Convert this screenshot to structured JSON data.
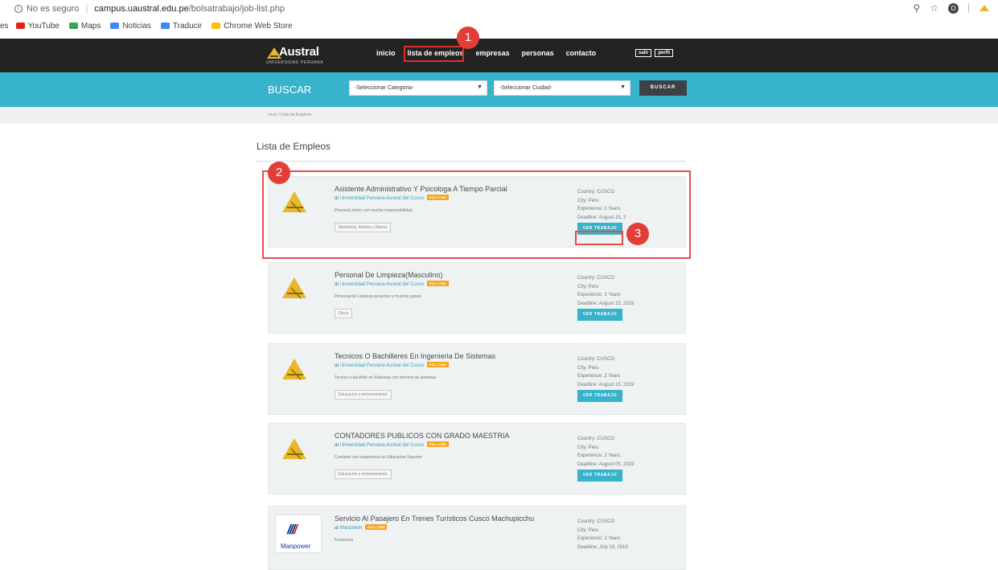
{
  "browser": {
    "insecure_label": "No es seguro",
    "url_host": "campus.uaustral.edu.pe",
    "url_path": "/bolsatrabajo/job-list.php",
    "bookmarks": [
      {
        "label": "es"
      },
      {
        "label": "YouTube",
        "color": "#e62117"
      },
      {
        "label": "Maps",
        "color": "#34a853"
      },
      {
        "label": "Noticias",
        "color": "#4285f4"
      },
      {
        "label": "Traducir",
        "color": "#4285f4"
      },
      {
        "label": "Chrome Web Store",
        "color": "#fbbc05"
      }
    ]
  },
  "site": {
    "logo_name": "Austral",
    "logo_sub": "UNIVERSIDAD PERUANA",
    "menu": [
      "inicio",
      "lista de empleos",
      "empresas",
      "personas",
      "contacto"
    ],
    "mini_buttons": [
      "salir",
      "perfil"
    ],
    "search": {
      "label": "BUSCAR",
      "category_placeholder": "-Seleccionar Categoria-",
      "city_placeholder": "-Seleccionar Ciudad-",
      "button": "BUSCAR"
    },
    "breadcrumb": {
      "home": "Inicio",
      "sep": "/",
      "current": "Lista de Empleos"
    },
    "page_title": "Lista de Empleos"
  },
  "jobs": [
    {
      "title": "Asistente Administrativo Y Psicologa A Tiempo Parcial",
      "at": "at",
      "company": "Universidad Peruana Austral del Cusco",
      "badge": "FULL-TIME",
      "desc": "Personal activo con mucha responsabilidad",
      "tag": "Marketing, Medios y Marca",
      "country": "Country: CUSCO",
      "city": "City: Peru",
      "experience": "Experience: 2 Years",
      "deadline": "Deadline: August 15, 2",
      "button": "VER TRABAJO"
    },
    {
      "title": "Personal De Limpieza(Masculino)",
      "at": "at",
      "company": "Universidad Peruana Austral del Cusco",
      "badge": "FULL-TIME",
      "desc": "Personal de Limpieza proactivo y muchas ganas",
      "tag": "Otros",
      "country": "Country: CUSCO",
      "city": "City: Peru",
      "experience": "Experience: 2 Years",
      "deadline": "Deadline: August 15, 2019",
      "button": "VER TRABAJO"
    },
    {
      "title": "Tecnicos O Bachilleres En Ingenieria De Sistemas",
      "at": "at",
      "company": "Universidad Peruana Austral del Cusco",
      "badge": "FULL-TIME",
      "desc": "Tecnico o bachiller en Sistemas con dominio de sistemas",
      "tag": "Educacion y entrenamiento",
      "country": "Country: CUSCO",
      "city": "City: Peru",
      "experience": "Experience: 2 Years",
      "deadline": "Deadline: August 15, 2019",
      "button": "VER TRABAJO"
    },
    {
      "title": "CONTADORES PUBLICOS CON GRADO MAESTRIA",
      "at": "at",
      "company": "Universidad Peruana Austral del Cusco",
      "badge": "FULL-TIME",
      "desc": "Contador con experiencia en Educacion Superior",
      "tag": "Educacion y entrenamiento",
      "country": "Country: CUSCO",
      "city": "City: Peru",
      "experience": "Experience: 2 Years",
      "deadline": "Deadline: August 05, 2019",
      "button": "VER TRABAJO"
    },
    {
      "title": "Servicio Al Pasajero En Trenes Turísticos Cusco Machupicchu",
      "at": "at",
      "company": "Manpower",
      "badge": "FULL-TIME",
      "desc": "Funciones",
      "country": "Country: CUSCO",
      "city": "City: Peru",
      "experience": "Experience: 2 Years",
      "deadline": "Deadline: July 19, 2019",
      "logo_text": "Manpower"
    }
  ],
  "annotations": [
    "1",
    "2",
    "3"
  ],
  "colors": {
    "accent": "#37b3cb",
    "nav": "#232323",
    "badge": "#f5a623",
    "annotation": "#e23d36"
  }
}
